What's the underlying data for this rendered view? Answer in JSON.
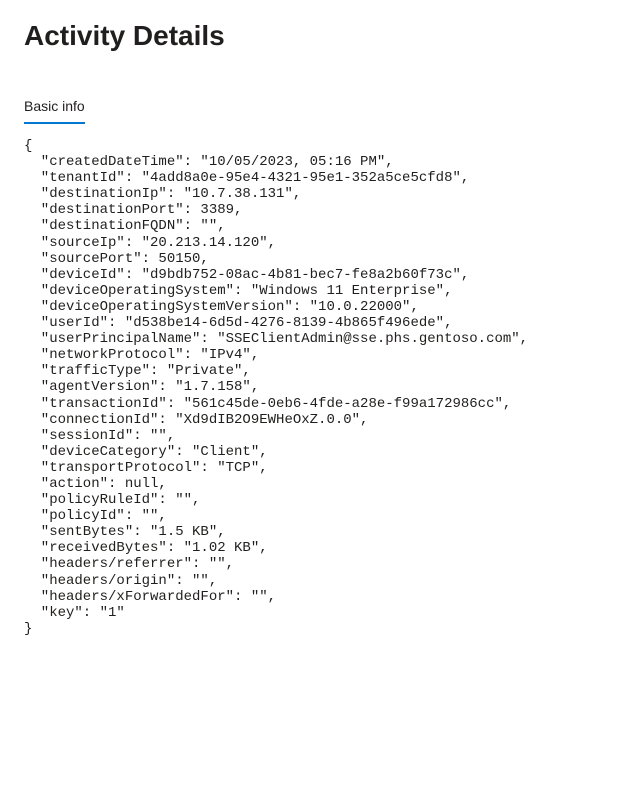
{
  "page": {
    "title": "Activity Details"
  },
  "tabs": {
    "basic_info": "Basic info"
  },
  "details": {
    "createdDateTime": "10/05/2023, 05:16 PM",
    "tenantId": "4add8a0e-95e4-4321-95e1-352a5ce5cfd8",
    "destinationIp": "10.7.38.131",
    "destinationPort": 3389,
    "destinationFQDN": "",
    "sourceIp": "20.213.14.120",
    "sourcePort": 50150,
    "deviceId": "d9bdb752-08ac-4b81-bec7-fe8a2b60f73c",
    "deviceOperatingSystem": "Windows 11 Enterprise",
    "deviceOperatingSystemVersion": "10.0.22000",
    "userId": "d538be14-6d5d-4276-8139-4b865f496ede",
    "userPrincipalName": "SSEClientAdmin@sse.phs.gentoso.com",
    "networkProtocol": "IPv4",
    "trafficType": "Private",
    "agentVersion": "1.7.158",
    "transactionId": "561c45de-0eb6-4fde-a28e-f99a172986cc",
    "connectionId": "Xd9dIB2O9EWHeOxZ.0.0",
    "sessionId": "",
    "deviceCategory": "Client",
    "transportProtocol": "TCP",
    "action": null,
    "policyRuleId": "",
    "policyId": "",
    "sentBytes": "1.5 KB",
    "receivedBytes": "1.02 KB",
    "headers/referrer": "",
    "headers/origin": "",
    "headers/xForwardedFor": "",
    "key": "1"
  },
  "detailsOrder": [
    "createdDateTime",
    "tenantId",
    "destinationIp",
    "destinationPort",
    "destinationFQDN",
    "sourceIp",
    "sourcePort",
    "deviceId",
    "deviceOperatingSystem",
    "deviceOperatingSystemVersion",
    "userId",
    "userPrincipalName",
    "networkProtocol",
    "trafficType",
    "agentVersion",
    "transactionId",
    "connectionId",
    "sessionId",
    "deviceCategory",
    "transportProtocol",
    "action",
    "policyRuleId",
    "policyId",
    "sentBytes",
    "receivedBytes",
    "headers/referrer",
    "headers/origin",
    "headers/xForwardedFor",
    "key"
  ]
}
